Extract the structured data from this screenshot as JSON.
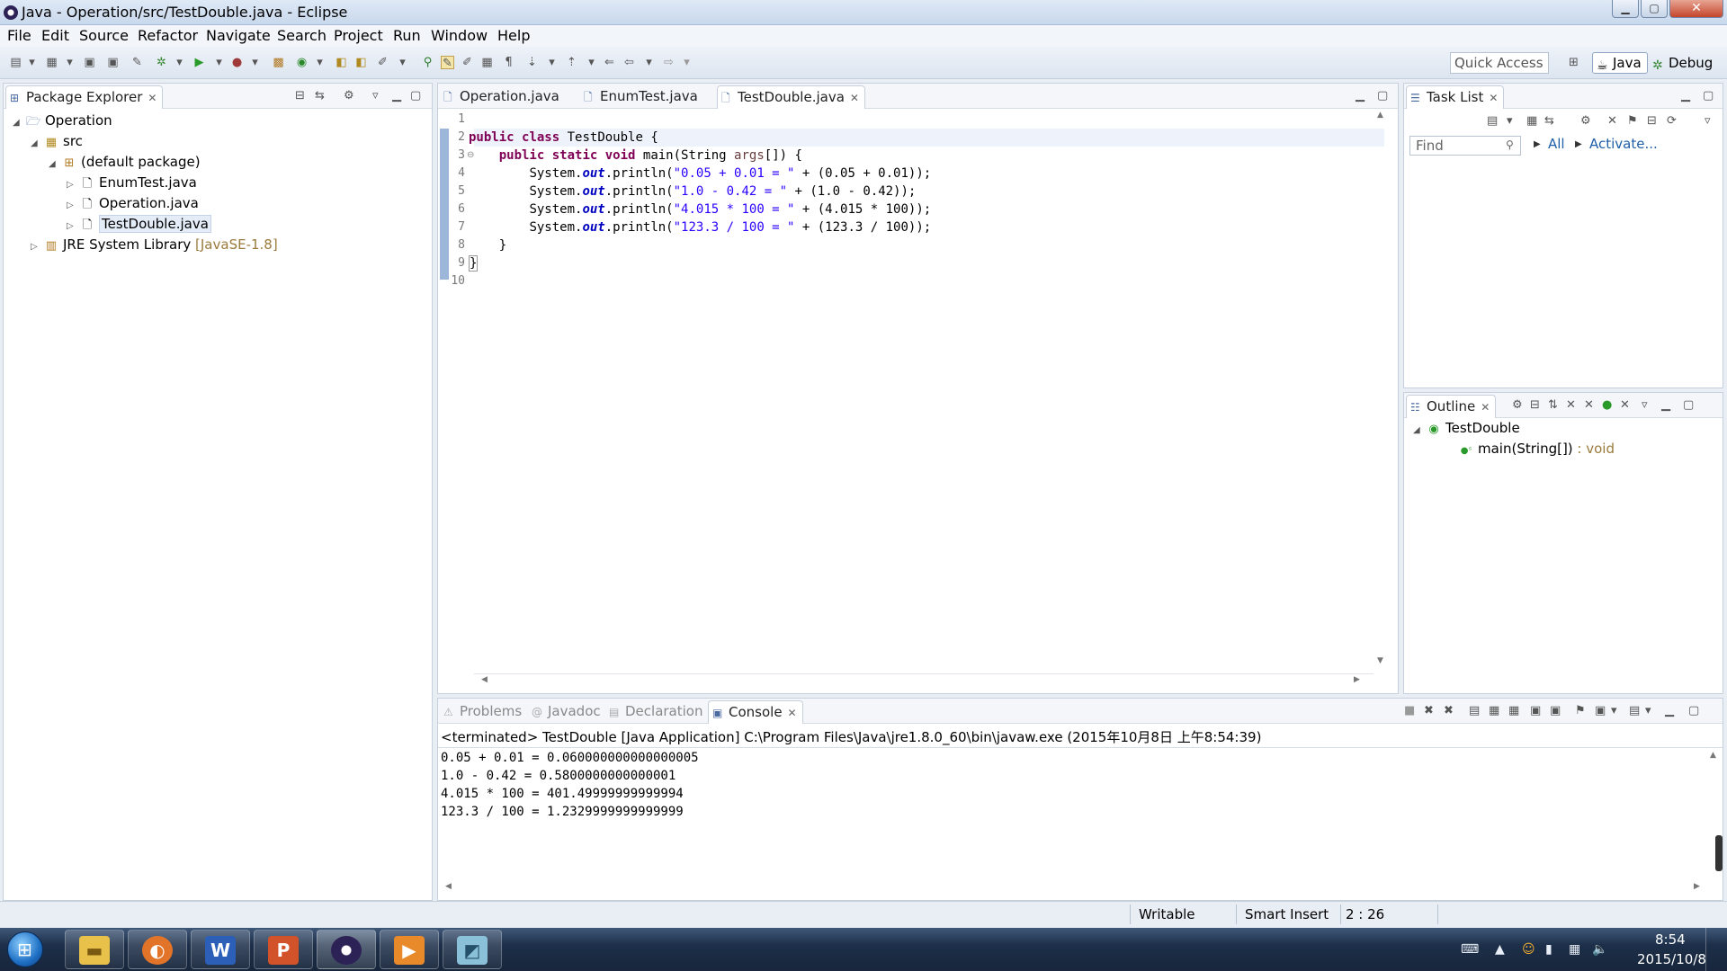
{
  "window": {
    "title": "Java - Operation/src/TestDouble.java - Eclipse"
  },
  "menu": [
    "File",
    "Edit",
    "Source",
    "Refactor",
    "Navigate",
    "Search",
    "Project",
    "Run",
    "Window",
    "Help"
  ],
  "toolbar": {
    "quick_access": "Quick Access",
    "perspectives": {
      "java": "Java",
      "debug": "Debug"
    }
  },
  "package_explorer": {
    "tab_label": "Package Explorer",
    "tree": {
      "project": "Operation",
      "src": "src",
      "package": "(default package)",
      "files": [
        "EnumTest.java",
        "Operation.java",
        "TestDouble.java"
      ],
      "library": "JRE System Library",
      "library_version": "[JavaSE-1.8]"
    }
  },
  "editor": {
    "tabs": [
      "Operation.java",
      "EnumTest.java",
      "TestDouble.java"
    ],
    "active_tab": "TestDouble.java",
    "line_numbers": [
      "1",
      "2",
      "3",
      "4",
      "5",
      "6",
      "7",
      "8",
      "9",
      "10"
    ],
    "code": {
      "kw_public": "public",
      "kw_class": "class",
      "class_name": " TestDouble {",
      "kw_static": "static",
      "kw_void": "void",
      "main_sig": " main(String ",
      "param": "args",
      "main_end": "[]) {",
      "sys": "System.",
      "out": "out",
      "println": ".println(",
      "s1": "\"0.05 + 0.01 = \"",
      "e1": " + (0.05 + 0.01));",
      "s2": "\"1.0 - 0.42 = \"",
      "e2": " + (1.0 - 0.42));",
      "s3": "\"4.015 * 100 = \"",
      "e3": " + (4.015 * 100));",
      "s4": "\"123.3 / 100 = \"",
      "e4": " + (123.3 / 100));",
      "close_method": "}",
      "close_class": "}"
    }
  },
  "task_list": {
    "tab_label": "Task List",
    "find_placeholder": "Find",
    "all_label": "All",
    "activate_label": "Activate..."
  },
  "outline": {
    "tab_label": "Outline",
    "class_name": "TestDouble",
    "method": "main(String[])",
    "method_type": " : void"
  },
  "bottom_panel": {
    "tabs": [
      "Problems",
      "Javadoc",
      "Declaration",
      "Console"
    ],
    "active_tab": "Console",
    "status_line": "<terminated> TestDouble [Java Application] C:\\Program Files\\Java\\jre1.8.0_60\\bin\\javaw.exe (2015年10月8日 上午8:54:39)",
    "output": [
      "0.05 + 0.01 = 0.060000000000000005",
      "1.0 - 0.42 = 0.5800000000000001",
      "4.015 * 100 = 401.49999999999994",
      "123.3 / 100 = 1.2329999999999999"
    ]
  },
  "status_bar": {
    "writable": "Writable",
    "insert_mode": "Smart Insert",
    "position": "2 : 26"
  },
  "taskbar": {
    "time": "8:54",
    "date": "2015/10/8"
  },
  "colors": {
    "keyword": "#7f0055",
    "string": "#2a00ff",
    "field": "#0000c0",
    "selection": "#e4ecf7"
  }
}
